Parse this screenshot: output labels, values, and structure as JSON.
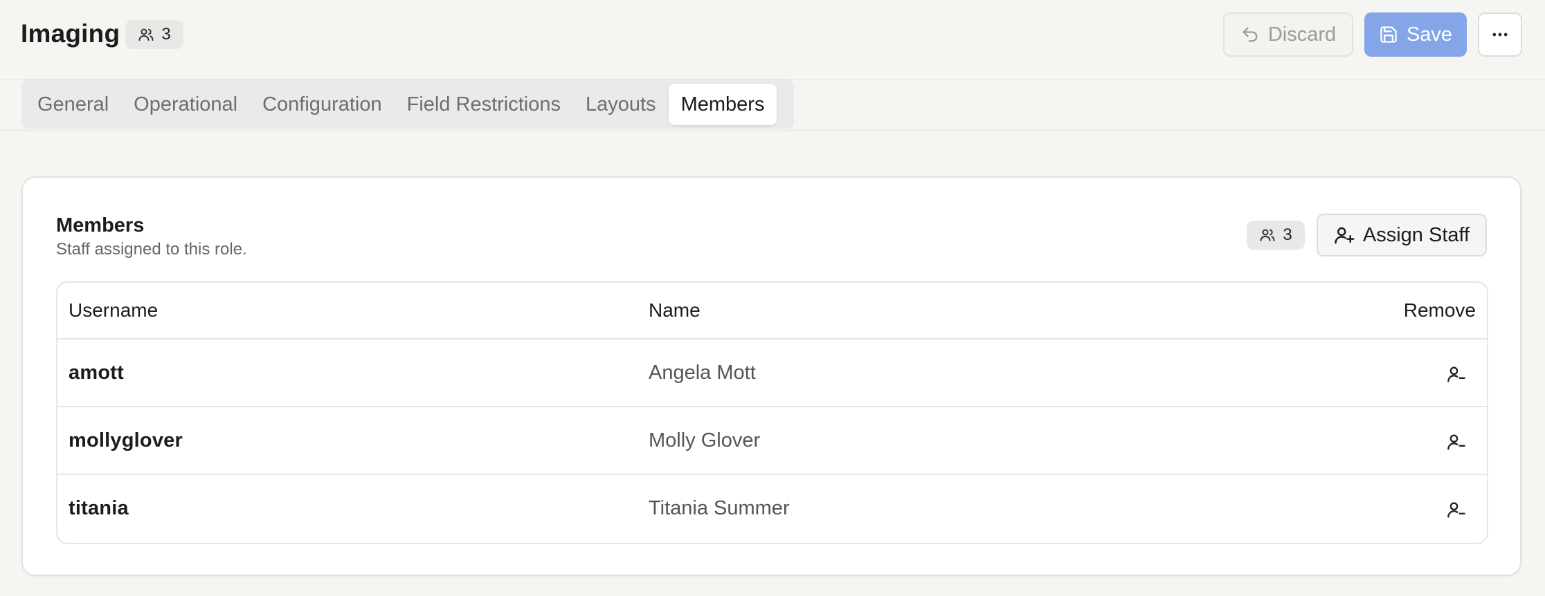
{
  "header": {
    "title": "Imaging",
    "member_count": "3",
    "discard_label": "Discard",
    "save_label": "Save"
  },
  "tabs": [
    {
      "label": "General"
    },
    {
      "label": "Operational"
    },
    {
      "label": "Configuration"
    },
    {
      "label": "Field Restrictions"
    },
    {
      "label": "Layouts"
    },
    {
      "label": "Members",
      "active": true
    }
  ],
  "card": {
    "title": "Members",
    "subtitle": "Staff assigned to this role.",
    "count": "3",
    "assign_label": "Assign Staff"
  },
  "table": {
    "columns": [
      "Username",
      "Name",
      "Remove"
    ],
    "rows": [
      {
        "username": "amott",
        "name": "Angela Mott"
      },
      {
        "username": "mollyglover",
        "name": "Molly Glover"
      },
      {
        "username": "titania",
        "name": "Titania Summer"
      }
    ]
  },
  "colors": {
    "background": "#f6f5f1",
    "save_button": "#84a5e8",
    "active_tab": "#ffffff",
    "badge": "#e8e8e6"
  },
  "icons": {
    "users": "users-icon",
    "undo": "undo-icon",
    "save": "save-icon",
    "more": "more-horizontal-icon",
    "assign": "user-plus-icon",
    "remove": "user-minus-icon"
  }
}
